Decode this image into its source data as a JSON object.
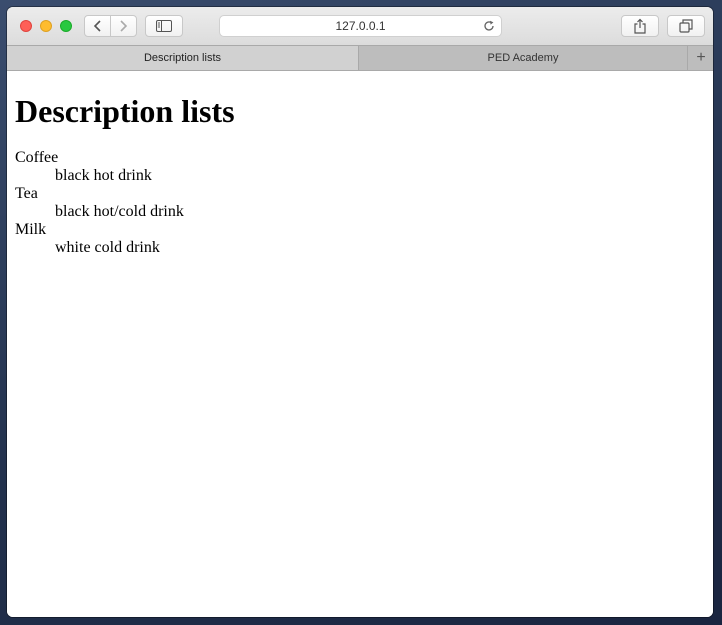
{
  "browser": {
    "url": "127.0.0.1",
    "tabs": [
      {
        "label": "Description lists",
        "active": true
      },
      {
        "label": "PED Academy",
        "active": false
      }
    ],
    "new_tab_label": "+"
  },
  "page": {
    "heading": "Description lists",
    "items": [
      {
        "term": "Coffee",
        "description": "black hot drink"
      },
      {
        "term": "Tea",
        "description": "black hot/cold drink"
      },
      {
        "term": "Milk",
        "description": "white cold drink"
      }
    ]
  },
  "colors": {
    "close": "#fe5f57",
    "minimize": "#febc2e",
    "maximize": "#28c840"
  }
}
